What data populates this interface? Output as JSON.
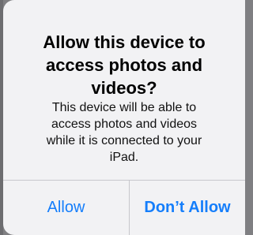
{
  "alert": {
    "title": "Allow this device to\naccess photos and\nvideos?",
    "message": "This device will be able to\naccess photos and videos\nwhile it is connected to your\niPad.",
    "buttons": {
      "allow": "Allow",
      "dont_allow": "Don’t Allow"
    }
  },
  "colors": {
    "accent": "#157EFB",
    "alert_background": "#F2F2F4",
    "separator": "#C7C7CC"
  }
}
